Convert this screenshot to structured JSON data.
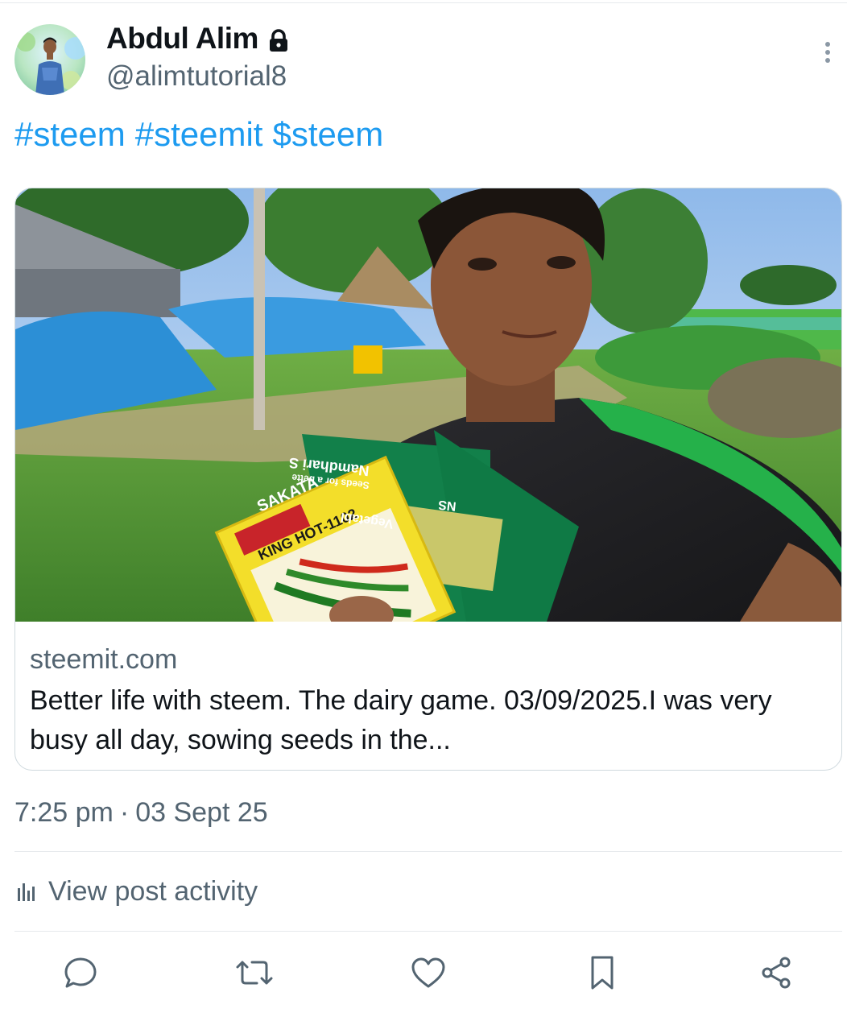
{
  "post": {
    "author": {
      "display_name": "Abdul Alim",
      "handle": "@alimtutorial8",
      "protected": true
    },
    "hashtags": [
      "#steem",
      "#steemit",
      "$steem"
    ],
    "link_card": {
      "domain": "steemit.com",
      "description": "Better life with steem. The dairy game. 03/09/2025.I was very busy all day, sowing seeds in the...",
      "image_text": {
        "packet_brand": "SAKATA",
        "packet_variety": "KING HOT-1102",
        "packet_brand_2": "Namdhari S",
        "packet_sub": "Seeds for a bette",
        "packet_label": "Vegetabl",
        "packet_logo": "NS"
      }
    },
    "time": "7:25 pm",
    "date": "03 Sept 25",
    "separator": "·",
    "activity_label": "View post activity"
  },
  "icons": {
    "lock": "lock-icon",
    "more": "more-options-icon",
    "analytics": "bar-chart-icon",
    "reply": "reply-icon",
    "repost": "repost-icon",
    "like": "heart-icon",
    "bookmark": "bookmark-icon",
    "share": "share-icon"
  },
  "colors": {
    "link": "#1d9bf0",
    "text_primary": "#0f1419",
    "text_secondary": "#536471",
    "border": "#cfd9de"
  }
}
